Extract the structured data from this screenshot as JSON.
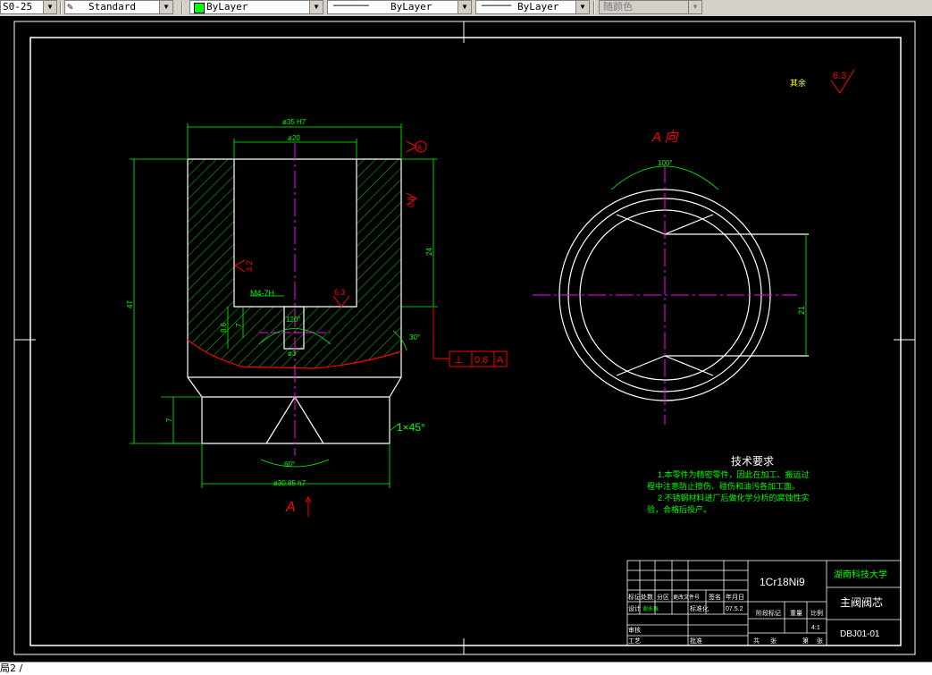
{
  "toolbar": {
    "dimstyle": "S0-25",
    "textstyle": "Standard",
    "layer": "ByLayer",
    "linetype": "ByLayer",
    "lineweight": "ByLayer",
    "plotstyle": "随颜色"
  },
  "colors": {
    "layer_swatch": "#00ff00",
    "background": "#000000"
  },
  "drawing": {
    "dim_top": "ø35 H7",
    "dim_inner": "ø20",
    "datum_top": "A",
    "roughness_right": "0.8",
    "dim_24": "24",
    "dim_47": "47",
    "roughness_left": "3.2",
    "thread": "M4-7H",
    "roughness_thread": "6.3",
    "angle_120": "120°",
    "dim_8_6": "8.6",
    "dim_7a": "7",
    "dim_3": "ø3",
    "angle_30": "30°",
    "tol_symbol": "⊥",
    "tol_value": "0.6",
    "tol_datum": "A",
    "dim_7b": "7",
    "chamfer": "1×45°",
    "angle_60": "60°",
    "dim_bottom": "ø30.85 h7",
    "section_label": "A",
    "view_label": "A 向",
    "angle_100": "100°",
    "dim_21": "21",
    "other_roughness_label": "其余",
    "other_roughness_value": "6.3"
  },
  "notes": {
    "title": "技术要求",
    "line1": "1.本零件为精密零件，因此在加工、搬运过",
    "line2": "程中注意防止擦伤、碰伤和油污各加工面。",
    "line3": "2.不锈钢材料进厂后做化学分析的腐蚀性实",
    "line4": "验，合格后投产。"
  },
  "title_block": {
    "material": "1Cr18Ni9",
    "school": "湖南科技大学",
    "part_name": "主阀阀芯",
    "drawing_no": "DBJ01-01",
    "scale": "4:1",
    "h_mark": "标记",
    "h_count": "处数",
    "h_zone": "分区",
    "h_doc": "更改文件号",
    "h_sign": "签名",
    "h_date": "年月日",
    "design": "设计",
    "designer": "谢永珠",
    "standardize": "标准化",
    "date": "07.5.2",
    "stage": "阶段标记",
    "weight": "重量",
    "ratio": "比例",
    "review": "审核",
    "process": "工艺",
    "approve": "批准",
    "total": "共",
    "sheet": "张",
    "num": "第",
    "sheet2": "张"
  },
  "status": {
    "text": "局2 /"
  }
}
